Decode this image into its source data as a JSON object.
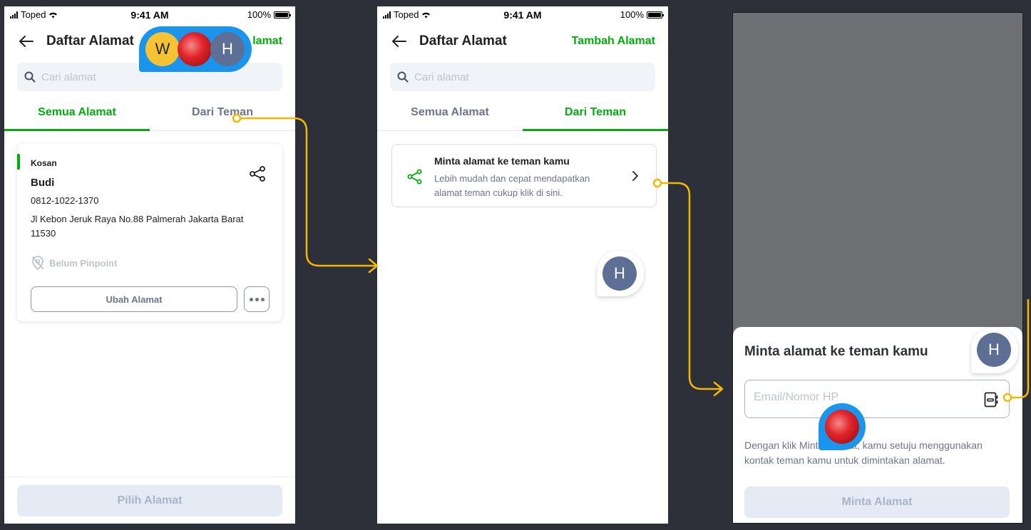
{
  "status_bar": {
    "carrier": "Toped",
    "time": "9:41 AM",
    "battery": "100%"
  },
  "screen1": {
    "header": {
      "title": "Daftar Alamat",
      "action_visible": "lamat"
    },
    "search": {
      "placeholder": "Cari alamat"
    },
    "tabs": [
      {
        "label": "Semua Alamat",
        "active": true
      },
      {
        "label": "Dari Teman",
        "active": false
      }
    ],
    "address_card": {
      "label": "Kosan",
      "name": "Budi",
      "phone": "0812-1022-1370",
      "address": "Jl Kebon Jeruk Raya No.88 Palmerah Jakarta Barat 11530",
      "pinpoint_status": "Belum Pinpoint",
      "edit_button": "Ubah Alamat"
    },
    "bottom_button": "Pilih Alamat"
  },
  "screen2": {
    "header": {
      "title": "Daftar Alamat",
      "action": "Tambah Alamat"
    },
    "search": {
      "placeholder": "Cari alamat"
    },
    "tabs": [
      {
        "label": "Semua Alamat",
        "active": false
      },
      {
        "label": "Dari Teman",
        "active": true
      }
    ],
    "invite_card": {
      "title": "Minta alamat ke teman kamu",
      "description": "Lebih mudah dan cepat mendapatkan alamat teman cukup klik di sini."
    }
  },
  "screen3": {
    "sheet": {
      "title": "Minta alamat ke teman kamu",
      "input_placeholder": "Email/Nomor HP",
      "terms": "Dengan klik Minta Alamat, kamu setuju menggunakan kontak teman kamu untuk dimintakan alamat.",
      "submit_button": "Minta Alamat"
    }
  },
  "collaborators": {
    "w_initial": "W",
    "h_initial": "H"
  },
  "colors": {
    "brand_green": "#03ac0e",
    "connector_yellow": "#f5b800",
    "collaborator_blue": "#1995ee",
    "canvas_background": "#2d3038"
  }
}
